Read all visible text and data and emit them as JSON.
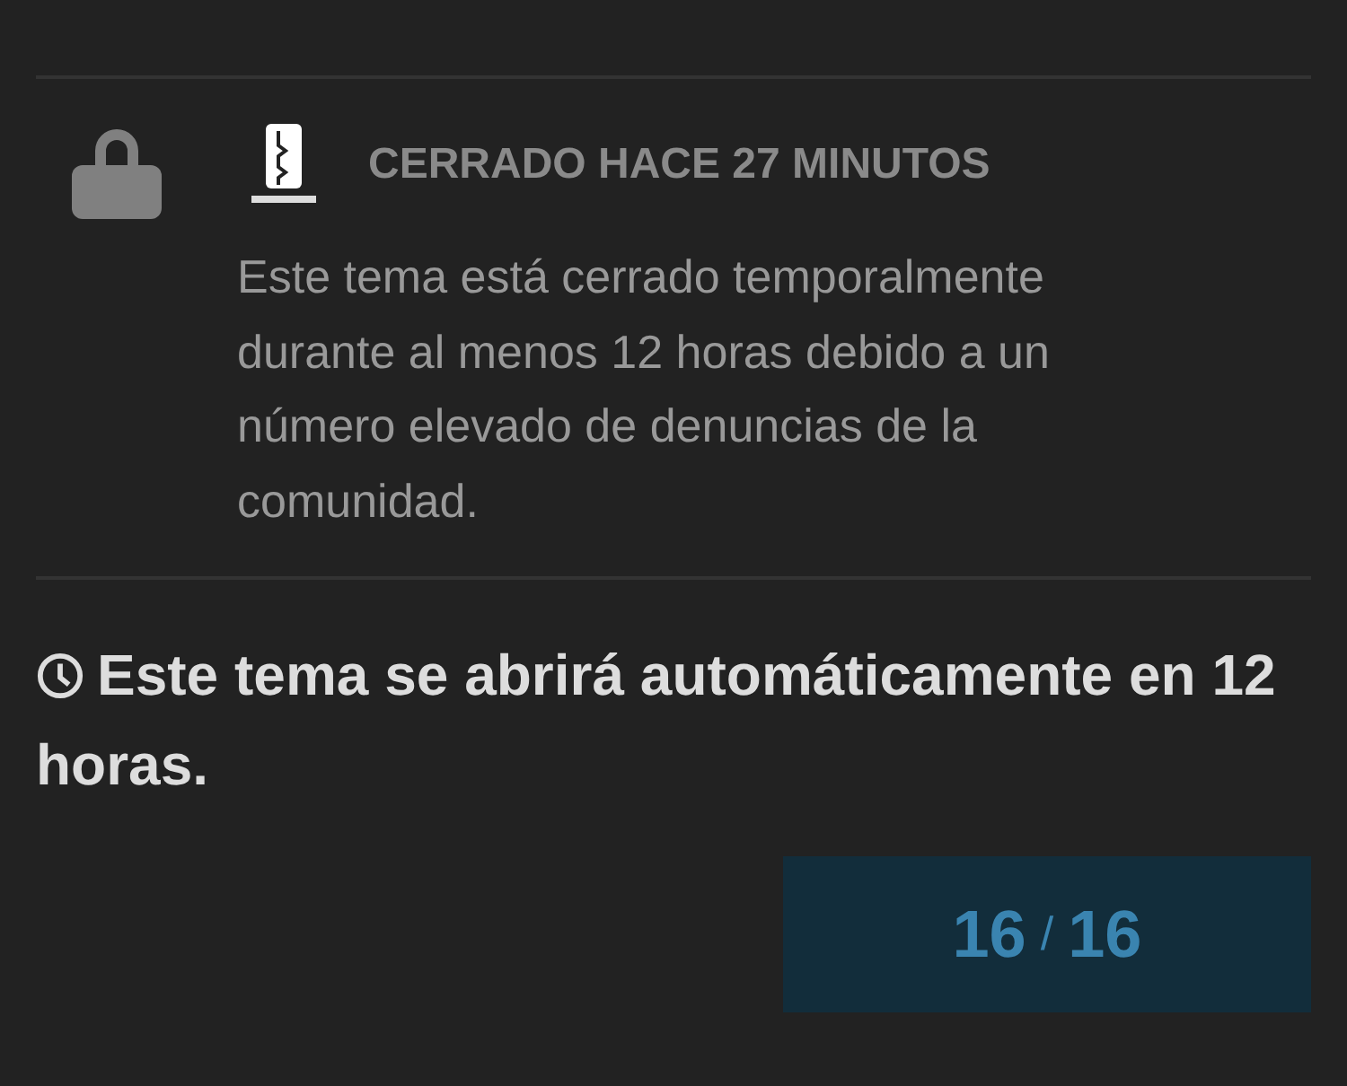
{
  "closed_notice": {
    "status": "CERRADO HACE 27 MINUTOS",
    "message": "Este tema está cerrado temporalmente durante al menos 12 horas debido a un número elevado de denuncias de la comunidad."
  },
  "auto_open_notice": "Este tema se abrirá automáticamente en 12 horas.",
  "progress": {
    "current": "16",
    "separator": "/",
    "total": "16"
  }
}
